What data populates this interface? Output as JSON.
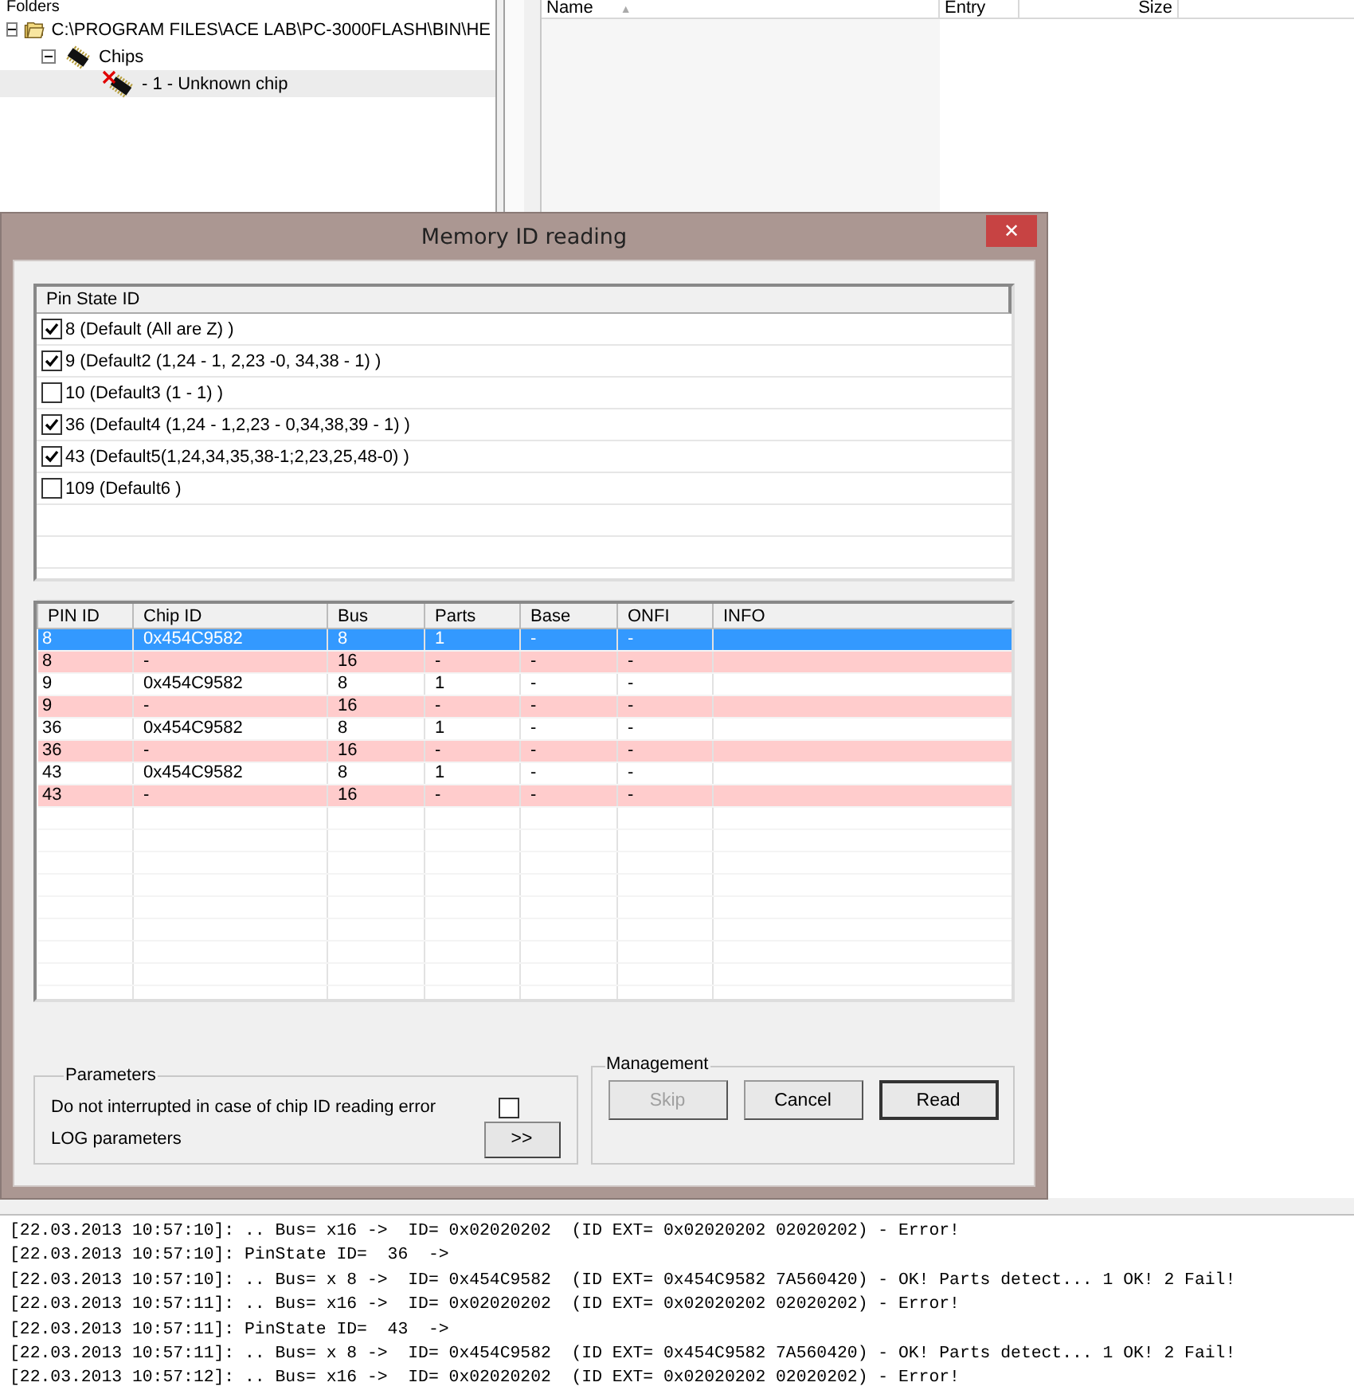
{
  "folders_panel": {
    "title": "Folders",
    "tree": [
      {
        "label": "C:\\PROGRAM FILES\\ACE LAB\\PC-3000FLASH\\BIN\\HE",
        "kind": "folder",
        "expanded": true,
        "selected": false,
        "children": [
          {
            "label": "Chips",
            "kind": "chips",
            "expanded": true,
            "selected": false,
            "children": [
              {
                "label": "-  1 - Unknown chip",
                "kind": "bad-chip",
                "selected": true
              }
            ]
          }
        ]
      }
    ]
  },
  "file_list": {
    "columns": [
      {
        "label": "Name",
        "sort_icon": "▲"
      },
      {
        "label": "Entry"
      },
      {
        "label": "Size"
      }
    ]
  },
  "dialog": {
    "title": "Memory ID reading",
    "close": "✕",
    "pin_states": {
      "header": "Pin State ID",
      "items": [
        {
          "label": "8 (Default (All are Z) )",
          "checked": true
        },
        {
          "label": "9 (Default2 (1,24 - 1, 2,23 -0, 34,38 - 1) )",
          "checked": true
        },
        {
          "label": "10 (Default3 (1 - 1) )",
          "checked": false
        },
        {
          "label": "36 (Default4 (1,24 - 1,2,23 - 0,34,38,39 - 1) )",
          "checked": true
        },
        {
          "label": "43 (Default5(1,24,34,35,38-1;2,23,25,48-0) )",
          "checked": true
        },
        {
          "label": "109 (Default6 )",
          "checked": false
        }
      ]
    },
    "results": {
      "columns": [
        "PIN ID",
        "Chip ID",
        "Bus",
        "Parts",
        "Base",
        "ONFI",
        "INFO"
      ],
      "rows": [
        {
          "kind": "ok",
          "selected": true,
          "cells": [
            "8",
            "0x454C9582",
            "8",
            "1",
            "-",
            "-"
          ]
        },
        {
          "kind": "error",
          "selected": false,
          "cells": [
            "8",
            "-",
            "16",
            "-",
            "-",
            "-"
          ]
        },
        {
          "kind": "ok",
          "selected": false,
          "cells": [
            "9",
            "0x454C9582",
            "8",
            "1",
            "-",
            "-"
          ]
        },
        {
          "kind": "error",
          "selected": false,
          "cells": [
            "9",
            "-",
            "16",
            "-",
            "-",
            "-"
          ]
        },
        {
          "kind": "ok",
          "selected": false,
          "cells": [
            "36",
            "0x454C9582",
            "8",
            "1",
            "-",
            "-"
          ]
        },
        {
          "kind": "error",
          "selected": false,
          "cells": [
            "36",
            "-",
            "16",
            "-",
            "-",
            "-"
          ]
        },
        {
          "kind": "ok",
          "selected": false,
          "cells": [
            "43",
            "0x454C9582",
            "8",
            "1",
            "-",
            "-"
          ]
        },
        {
          "kind": "error",
          "selected": false,
          "cells": [
            "43",
            "-",
            "16",
            "-",
            "-",
            "-"
          ]
        }
      ]
    },
    "parameters": {
      "title": "Parameters",
      "dont_interrupt": {
        "label": "Do not interrupted in case of chip ID reading error",
        "checked": false
      },
      "log_parameters": {
        "label": "LOG parameters",
        "button": ">>"
      }
    },
    "management": {
      "title": "Management",
      "buttons": [
        {
          "label": "Skip",
          "disabled": true,
          "default": false
        },
        {
          "label": "Cancel",
          "disabled": false,
          "default": false
        },
        {
          "label": "Read",
          "disabled": false,
          "default": true
        }
      ]
    }
  },
  "log": [
    "[22.03.2013 10:57:10]: .. Bus= x16 ->  ID= 0x02020202  (ID EXT= 0x02020202 02020202) - Error!",
    "[22.03.2013 10:57:10]: PinState ID=  36  ->",
    "[22.03.2013 10:57:10]: .. Bus= x 8 ->  ID= 0x454C9582  (ID EXT= 0x454C9582 7A560420) - OK! Parts detect... 1 OK! 2 Fail!",
    "[22.03.2013 10:57:11]: .. Bus= x16 ->  ID= 0x02020202  (ID EXT= 0x02020202 02020202) - Error!",
    "[22.03.2013 10:57:11]: PinState ID=  43  ->",
    "[22.03.2013 10:57:11]: .. Bus= x 8 ->  ID= 0x454C9582  (ID EXT= 0x454C9582 7A560420) - OK! Parts detect... 1 OK! 2 Fail!",
    "[22.03.2013 10:57:12]: .. Bus= x16 ->  ID= 0x02020202  (ID EXT= 0x02020202 02020202) - Error!"
  ]
}
